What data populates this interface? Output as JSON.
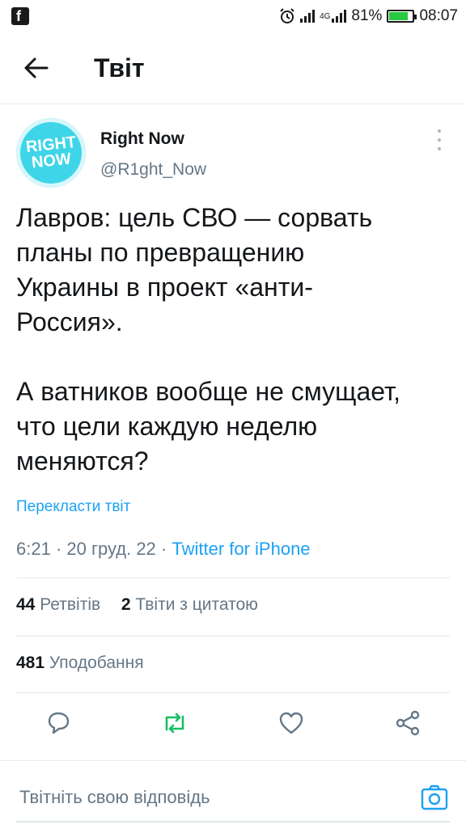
{
  "status_bar": {
    "battery": "81%",
    "time": "08:07",
    "network": "4G",
    "battery_level": 0.81
  },
  "header": {
    "title": "Твіт"
  },
  "tweet": {
    "avatar_text_1": "RIGHT",
    "avatar_text_2": "NOW",
    "author_name": "Right Now",
    "author_handle": "@R1ght_Now",
    "text": "Лавров: цель СВО — сорвать\nпланы по превращению\nУкраины в проект «анти-\nРоссия».\n\nА ватников вообще не смущает,\nчто цели каждую неделю\nменяются?",
    "translate_label": "Перекласти твіт",
    "time": "6:21",
    "date": "20 груд. 22",
    "source": "Twitter for iPhone",
    "separator": " · "
  },
  "stats": {
    "retweets_count": "44",
    "retweets_label": "Ретвітів",
    "quotes_count": "2",
    "quotes_label": "Твіти з цитатою",
    "likes_count": "481",
    "likes_label": "Уподобання"
  },
  "actions": {
    "reply_icon": "speech-bubble-icon",
    "retweet_icon": "retweet-icon",
    "like_icon": "heart-icon",
    "share_icon": "share-icon"
  },
  "reply": {
    "placeholder": "Твітніть свою відповідь"
  },
  "colors": {
    "accent": "#1da1f2",
    "retweet": "#17bf63",
    "secondary_text": "#657786",
    "avatar": "#3fd5e8"
  }
}
